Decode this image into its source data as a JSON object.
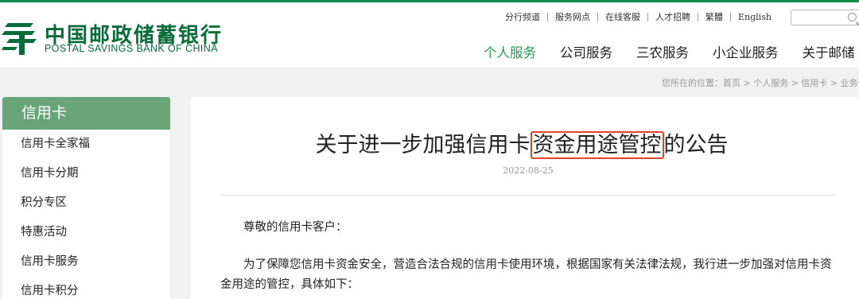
{
  "header": {
    "logo_cn": "中国邮政储蓄银行",
    "logo_en": "POSTAL SAVINGS BANK OF CHINA",
    "top_links": [
      "分行频道",
      "服务网点",
      "在线客服",
      "人才招聘",
      "繁體",
      "English"
    ],
    "search_placeholder": "",
    "nav": [
      "个人服务",
      "公司服务",
      "三农服务",
      "小企业服务",
      "关于邮储"
    ],
    "active_nav": "个人服务",
    "brand_color": "#0a6b3a",
    "active_color": "#1f9a4f"
  },
  "breadcrumb": {
    "prefix": "您所在的位置：",
    "items": [
      "首页",
      "个人服务",
      "信用卡",
      "业务公告"
    ],
    "separator": " > "
  },
  "sidebar": {
    "title": "信用卡",
    "header_color": "#6aa57a",
    "items": [
      "信用卡全家福",
      "信用卡分期",
      "积分专区",
      "特惠活动",
      "信用卡服务",
      "信用卡积分"
    ]
  },
  "article": {
    "title_before": "关于进一步加强信用卡",
    "title_highlight": "资金用途管控",
    "title_after": "的公告",
    "highlight_color": "#e2432a",
    "date": "2022-08-25",
    "greeting": "尊敬的信用卡客户：",
    "paragraph": "为了保障您信用卡资金安全，营造合法合规的信用卡使用环境，根据国家有关法律法规，我行进一步加强对信用卡资金用途的管控，具体如下："
  }
}
